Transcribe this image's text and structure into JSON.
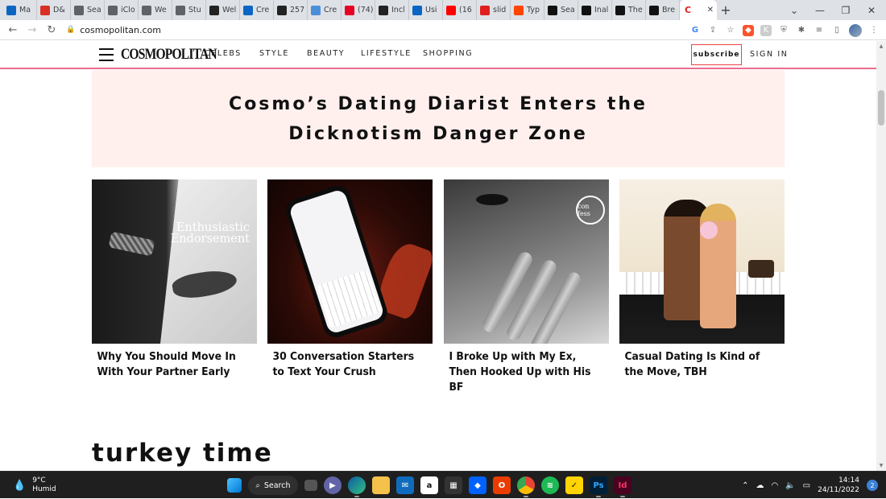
{
  "browser": {
    "tabs": [
      {
        "label": "Ma",
        "icon": "outlook-icon",
        "color": "#0a66c2"
      },
      {
        "label": "D&",
        "icon": "gmail-icon",
        "color": "#d93025"
      },
      {
        "label": "Sea",
        "icon": "globe-icon",
        "color": "#5f6368"
      },
      {
        "label": "iClo",
        "icon": "apple-icon",
        "color": "#5f6368"
      },
      {
        "label": "We",
        "icon": "globe-icon",
        "color": "#5f6368"
      },
      {
        "label": "Stu",
        "icon": "globe-icon",
        "color": "#5f6368"
      },
      {
        "label": "Wel",
        "icon": "tb-icon",
        "color": "#222"
      },
      {
        "label": "Cre",
        "icon": "play-icon",
        "color": "#0a66c2"
      },
      {
        "label": "257",
        "icon": "bb-icon",
        "color": "#222"
      },
      {
        "label": "Cre",
        "icon": "cloud-icon",
        "color": "#4a90d9"
      },
      {
        "label": "(74)",
        "icon": "pinterest-icon",
        "color": "#e60023"
      },
      {
        "label": "Incl",
        "icon": "box-icon",
        "color": "#222"
      },
      {
        "label": "Usi",
        "icon": "play-icon",
        "color": "#0a66c2"
      },
      {
        "label": "(16",
        "icon": "youtube-icon",
        "color": "#ff0000"
      },
      {
        "label": "slid",
        "icon": "adobe-icon",
        "color": "#e01e1e"
      },
      {
        "label": "Typ",
        "icon": "reddit-icon",
        "color": "#ff4500"
      },
      {
        "label": "Sea",
        "icon": "slash-icon",
        "color": "#111"
      },
      {
        "label": "Inal",
        "icon": "a-icon",
        "color": "#111"
      },
      {
        "label": "The",
        "icon": "dot-icon",
        "color": "#111"
      },
      {
        "label": "Bre",
        "icon": "slash-icon",
        "color": "#111"
      }
    ],
    "active_tab": {
      "label": "C",
      "icon": "cosmo-icon",
      "color": "#e01e1e"
    },
    "url": "cosmopolitan.com"
  },
  "site": {
    "logo": "COSMOPOLITAN",
    "nav": [
      "CELEBS",
      "STYLE",
      "BEAUTY",
      "LIFESTYLE",
      "SHOPPING"
    ],
    "subscribe": "subscribe",
    "signin": "SIGN IN",
    "hero_title_line1": "Cosmo’s Dating Diarist Enters the",
    "hero_title_line2": "Dicknotism Danger Zone",
    "cards": [
      {
        "caption": "Why You Should Move In With Your Partner Early",
        "overlay": "Enthusiastic Endorsement"
      },
      {
        "caption": "30 Conversation Starters to Text Your Crush"
      },
      {
        "caption": "I Broke Up with My Ex, Then Hooked Up with His BF",
        "seal": "con fess"
      },
      {
        "caption": "Casual Dating Is Kind of the Move, TBH"
      }
    ],
    "section_title": "turkey time"
  },
  "taskbar": {
    "temp": "9°C",
    "weather": "Humid",
    "search": "Search",
    "time": "14:14",
    "date": "24/11/2022",
    "notifications": "2"
  }
}
